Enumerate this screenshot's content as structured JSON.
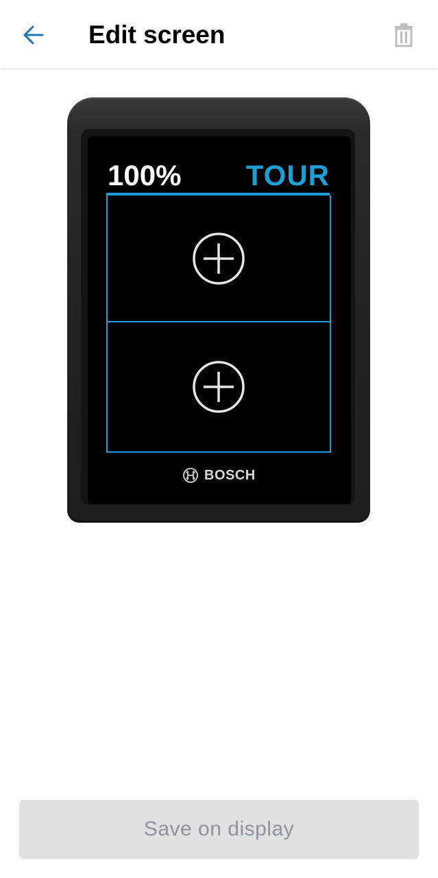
{
  "header": {
    "title": "Edit screen",
    "back_icon": "arrow-left-icon",
    "delete_icon": "trash-icon"
  },
  "device": {
    "battery": "100%",
    "mode": "TOUR",
    "slots": [
      {
        "icon": "add-circle-icon"
      },
      {
        "icon": "add-circle-icon"
      }
    ],
    "brand": "BOSCH",
    "brand_icon": "bosch-logo-icon"
  },
  "actions": {
    "save_label": "Save on display"
  },
  "colors": {
    "accent": "#1b9fd6",
    "back_arrow": "#1f78b4",
    "disabled_button_bg": "#e1e1e1",
    "disabled_button_text": "#8e949a"
  }
}
